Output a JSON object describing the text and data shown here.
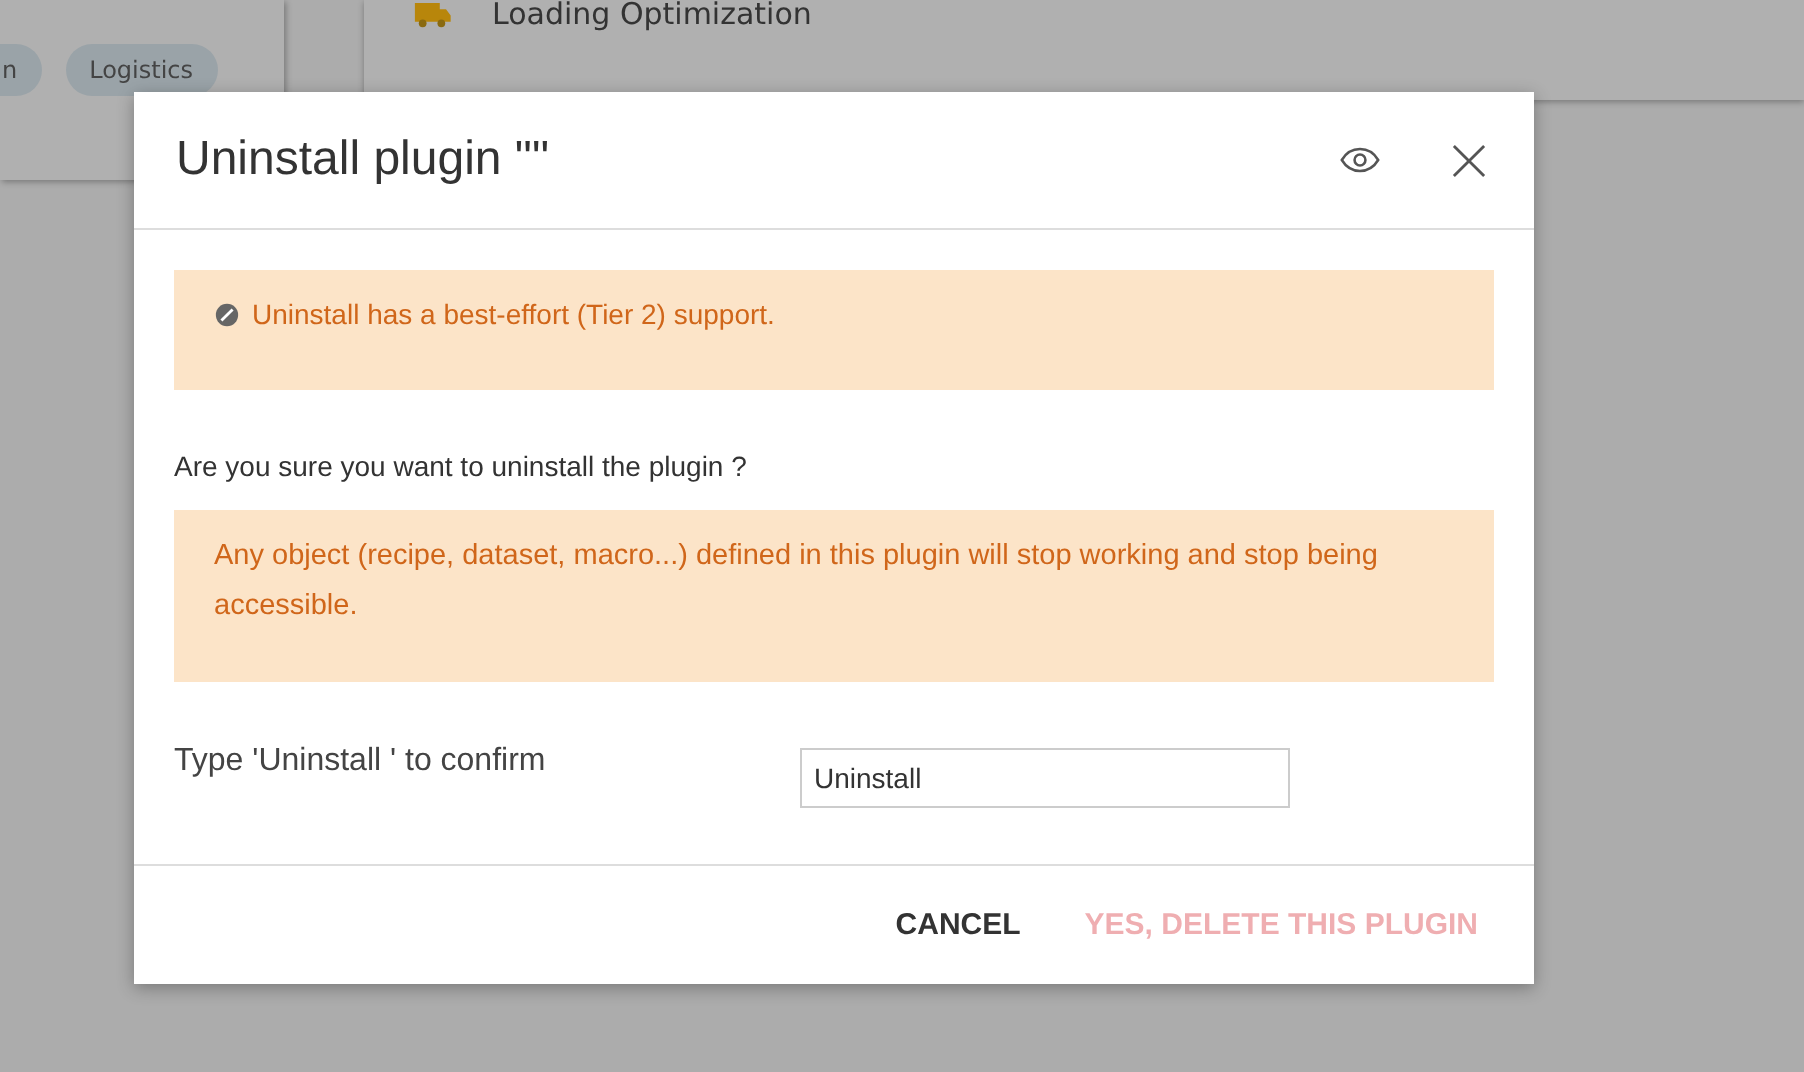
{
  "background": {
    "tags": [
      {
        "label": "n"
      },
      {
        "label": "Logistics"
      }
    ],
    "card_title": "Loading Optimization"
  },
  "dialog": {
    "title": "Uninstall plugin \"\"",
    "notice": "Uninstall has a best-effort (Tier 2) support.",
    "question": "Are you sure you want to uninstall the plugin ?",
    "warning": "Any object (recipe, dataset, macro...) defined in this plugin will stop working and stop being accessible.",
    "confirm_label": "Type 'Uninstall ' to confirm",
    "confirm_value": "Uninstall",
    "buttons": [
      {
        "label": "CANCEL",
        "kind": "cancel",
        "disabled": false
      },
      {
        "label": "YES, DELETE THIS PLUGIN",
        "kind": "danger",
        "disabled": true
      }
    ]
  }
}
